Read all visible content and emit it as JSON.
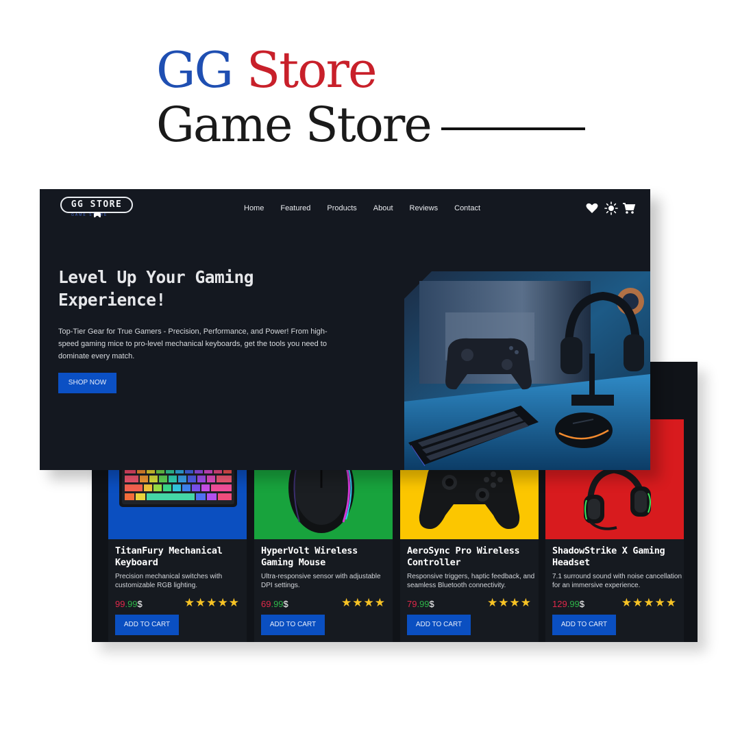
{
  "banner": {
    "title_part1": "GG",
    "title_part2": "Store",
    "subtitle": "Game Store"
  },
  "header": {
    "logo_text": "GG STORE",
    "logo_sub": "GAME STORE",
    "nav": [
      "Home",
      "Featured",
      "Products",
      "About",
      "Reviews",
      "Contact"
    ],
    "icons": [
      "heart-icon",
      "sun-icon",
      "cart-icon"
    ]
  },
  "hero": {
    "heading_line1": "Level Up Your Gaming",
    "heading_line2": "Experience!",
    "text": "Top-Tier Gear for True Gamers - Precision, Performance, and Power! From high-speed gaming mice to pro-level mechanical keyboards, get the tools you need to dominate every match.",
    "button": "SHOP NOW"
  },
  "products": [
    {
      "name": "TitanFury Mechanical Keyboard",
      "description": "Precision mechanical switches with customizable RGB lighting.",
      "price_int": "99",
      "price_dec": ".99",
      "currency": "$",
      "stars": "★★★★★",
      "rating": 5,
      "button": "ADD TO CART",
      "bg_color": "#0b4fc0"
    },
    {
      "name": "HyperVolt Wireless Gaming Mouse",
      "description": "Ultra-responsive sensor with adjustable DPI settings.",
      "price_int": "69",
      "price_dec": ".99",
      "currency": "$",
      "stars": "★★★★",
      "rating": 4,
      "button": "ADD TO CART",
      "bg_color": "#18a33d"
    },
    {
      "name": "AeroSync Pro Wireless Controller",
      "description": "Responsive triggers, haptic feedback, and seamless Bluetooth connectivity.",
      "price_int": "79",
      "price_dec": ".99",
      "currency": "$",
      "stars": "★★★★",
      "rating": 4,
      "button": "ADD TO CART",
      "bg_color": "#fcc600"
    },
    {
      "name": "ShadowStrike X Gaming Headset",
      "description": "7.1 surround sound with noise cancellation for an immersive experience.",
      "price_int": "129",
      "price_dec": ".99",
      "currency": "$",
      "stars": "★★★★★",
      "rating": 5,
      "button": "ADD TO CART",
      "bg_color": "#d81b1e"
    }
  ],
  "colors": {
    "brand_blue": "#1f4fb2",
    "brand_red": "#c8202a",
    "button_blue": "#0b50c4",
    "card_dark": "#141820",
    "star_yellow": "#f7c325"
  }
}
